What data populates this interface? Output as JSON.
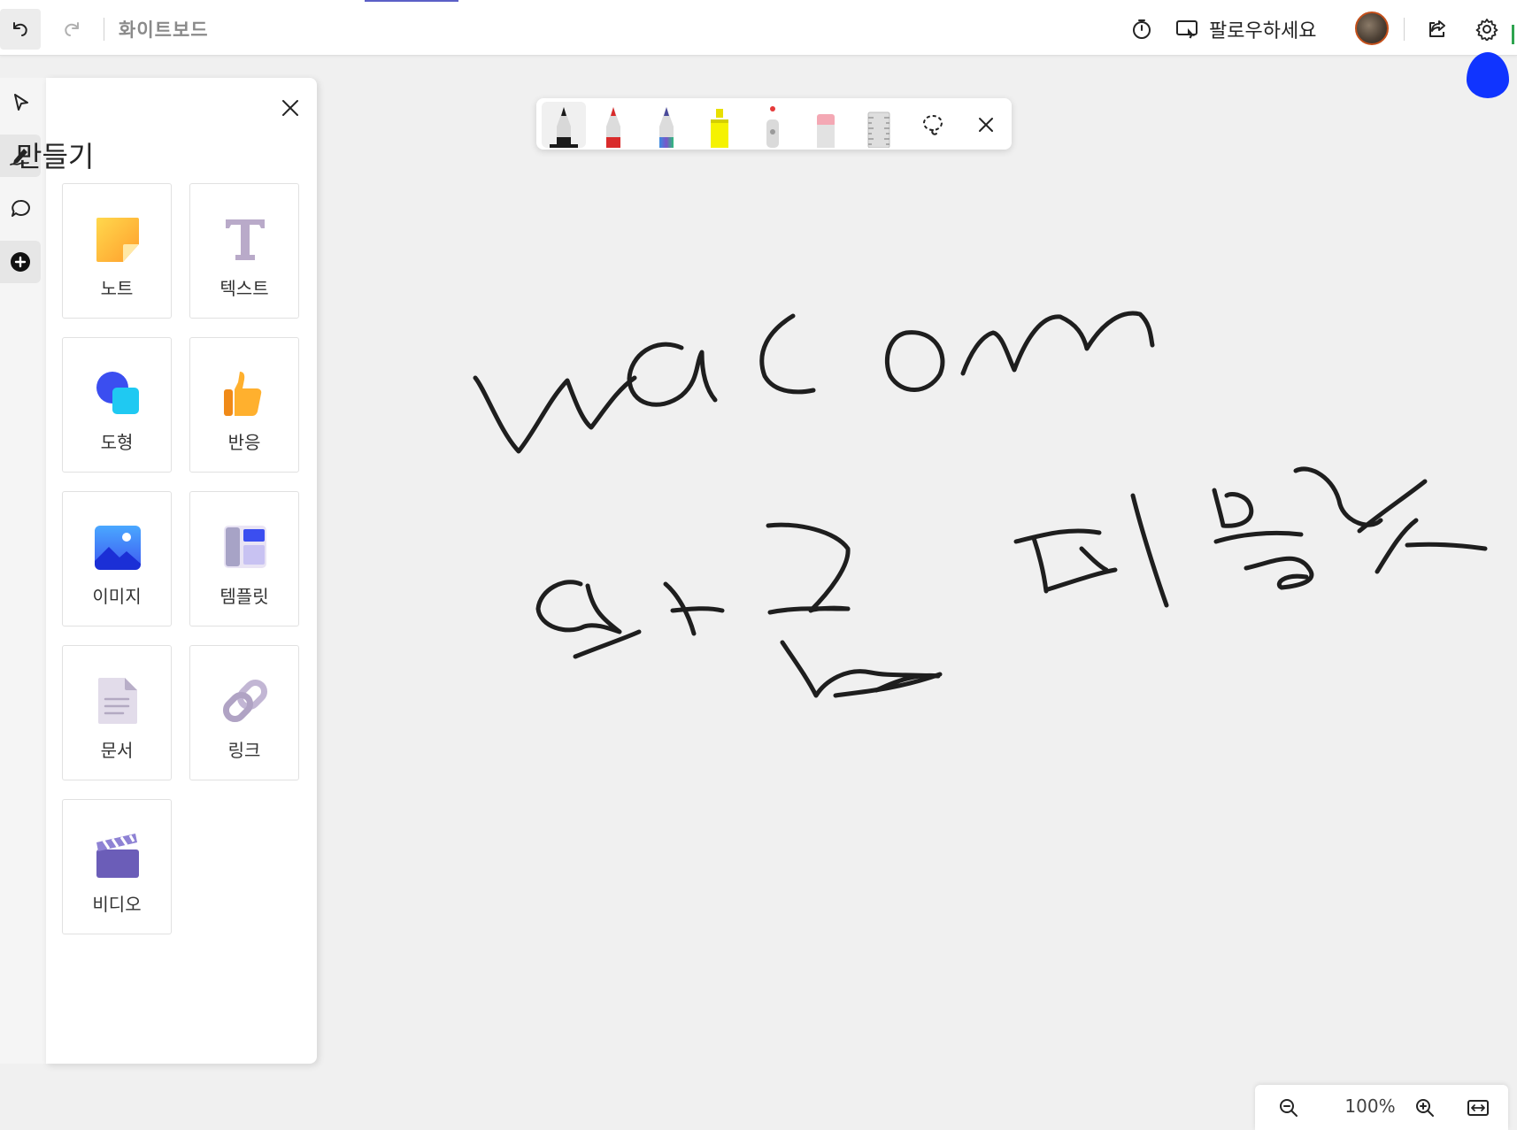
{
  "header": {
    "title": "화이트보드",
    "follow_label": "팔로우하세요",
    "icons": [
      "undo-icon",
      "redo-icon",
      "timer-icon",
      "follow-cast-icon",
      "share-icon",
      "gear-icon"
    ]
  },
  "rail": {
    "items": [
      {
        "name": "select",
        "icon": "pointer-icon"
      },
      {
        "name": "ink",
        "icon": "pen-icon",
        "active": true
      },
      {
        "name": "comment",
        "icon": "comment-icon"
      },
      {
        "name": "create",
        "icon": "add-circle-icon"
      }
    ]
  },
  "create_panel": {
    "title": "만들기",
    "items": [
      {
        "label": "노트",
        "icon": "sticky-note-icon"
      },
      {
        "label": "텍스트",
        "icon": "text-icon"
      },
      {
        "label": "도형",
        "icon": "shapes-icon"
      },
      {
        "label": "반응",
        "icon": "thumbs-up-icon"
      },
      {
        "label": "이미지",
        "icon": "image-icon"
      },
      {
        "label": "템플릿",
        "icon": "template-icon"
      },
      {
        "label": "문서",
        "icon": "document-icon"
      },
      {
        "label": "링크",
        "icon": "link-icon"
      },
      {
        "label": "비디오",
        "icon": "video-clapper-icon"
      }
    ]
  },
  "ink_toolbar": {
    "tools": [
      {
        "name": "black-pen",
        "color": "#1a1a1a",
        "active": true
      },
      {
        "name": "red-pen",
        "color": "#d92b2b"
      },
      {
        "name": "rainbow-pen",
        "color": "#7a55c9"
      },
      {
        "name": "highlighter",
        "color": "#f5f200"
      },
      {
        "name": "laser-pointer",
        "color": "#e53a3a"
      },
      {
        "name": "eraser",
        "color": "#f4a8b4"
      },
      {
        "name": "ruler",
        "color": "#cfcfcf"
      }
    ],
    "icons": [
      "lasso-select-icon",
      "close-icon"
    ]
  },
  "zoom": {
    "level": "100%",
    "icons": [
      "zoom-out-icon",
      "zoom-in-icon",
      "fit-to-screen-icon"
    ]
  },
  "colors": {
    "accent": "#5b5fc7",
    "avatar_ring": "#c4501b",
    "cursor_drop": "#1034ff",
    "ink": "#1e1e1e",
    "canvas_bg": "#f0f0f0"
  }
}
